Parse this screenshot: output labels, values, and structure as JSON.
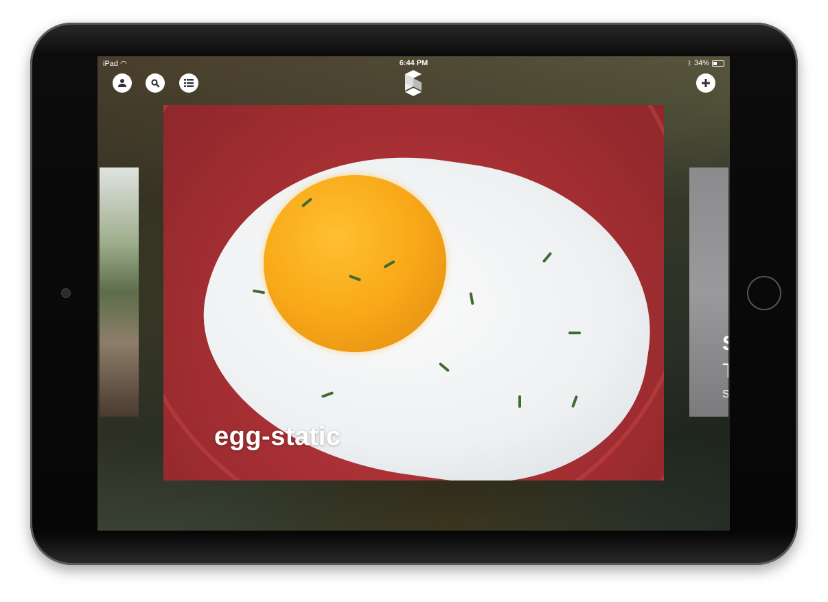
{
  "status_bar": {
    "device": "iPad",
    "time": "6:44 PM",
    "battery": "34%",
    "battery_level": 0.34
  },
  "toolbar": {
    "icons": [
      "user-icon",
      "search-icon",
      "list-icon",
      "app-logo",
      "plus-icon"
    ]
  },
  "cards": {
    "main": {
      "title": "egg-static"
    },
    "right": {
      "partial_lines": [
        "S",
        "T",
        "S"
      ]
    }
  },
  "colors": {
    "card_red": "#a83034",
    "yolk": "#f8a818"
  }
}
